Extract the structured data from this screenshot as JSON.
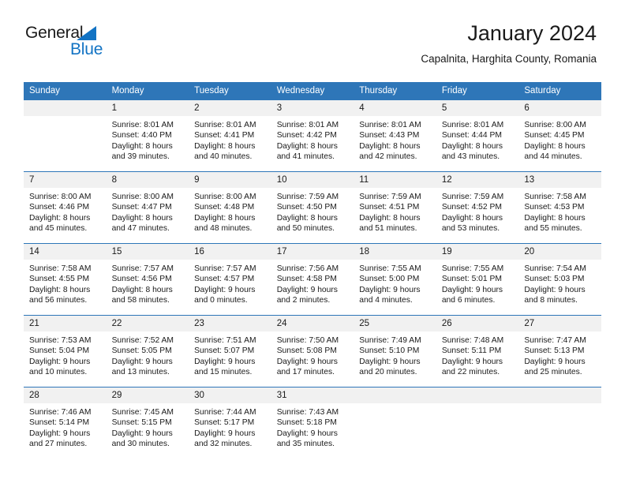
{
  "brand": {
    "name_part1": "General",
    "name_part2": "Blue",
    "triangle_color": "#1273c4"
  },
  "header": {
    "title": "January 2024",
    "location": "Capalnita, Harghita County, Romania"
  },
  "theme": {
    "header_blue": "#2e76b8",
    "daynum_gray": "#f1f1f1",
    "text": "#1a1a1a"
  },
  "labels": {
    "sunrise_prefix": "Sunrise:",
    "sunset_prefix": "Sunset:",
    "daylight_prefix": "Daylight:"
  },
  "weekday_headers": [
    "Sunday",
    "Monday",
    "Tuesday",
    "Wednesday",
    "Thursday",
    "Friday",
    "Saturday"
  ],
  "weeks": [
    [
      {
        "day": "",
        "sunrise": "",
        "sunset": "",
        "daylight_line1": "",
        "daylight_line2": ""
      },
      {
        "day": "1",
        "sunrise": "Sunrise: 8:01 AM",
        "sunset": "Sunset: 4:40 PM",
        "daylight_line1": "Daylight: 8 hours",
        "daylight_line2": "and 39 minutes."
      },
      {
        "day": "2",
        "sunrise": "Sunrise: 8:01 AM",
        "sunset": "Sunset: 4:41 PM",
        "daylight_line1": "Daylight: 8 hours",
        "daylight_line2": "and 40 minutes."
      },
      {
        "day": "3",
        "sunrise": "Sunrise: 8:01 AM",
        "sunset": "Sunset: 4:42 PM",
        "daylight_line1": "Daylight: 8 hours",
        "daylight_line2": "and 41 minutes."
      },
      {
        "day": "4",
        "sunrise": "Sunrise: 8:01 AM",
        "sunset": "Sunset: 4:43 PM",
        "daylight_line1": "Daylight: 8 hours",
        "daylight_line2": "and 42 minutes."
      },
      {
        "day": "5",
        "sunrise": "Sunrise: 8:01 AM",
        "sunset": "Sunset: 4:44 PM",
        "daylight_line1": "Daylight: 8 hours",
        "daylight_line2": "and 43 minutes."
      },
      {
        "day": "6",
        "sunrise": "Sunrise: 8:00 AM",
        "sunset": "Sunset: 4:45 PM",
        "daylight_line1": "Daylight: 8 hours",
        "daylight_line2": "and 44 minutes."
      }
    ],
    [
      {
        "day": "7",
        "sunrise": "Sunrise: 8:00 AM",
        "sunset": "Sunset: 4:46 PM",
        "daylight_line1": "Daylight: 8 hours",
        "daylight_line2": "and 45 minutes."
      },
      {
        "day": "8",
        "sunrise": "Sunrise: 8:00 AM",
        "sunset": "Sunset: 4:47 PM",
        "daylight_line1": "Daylight: 8 hours",
        "daylight_line2": "and 47 minutes."
      },
      {
        "day": "9",
        "sunrise": "Sunrise: 8:00 AM",
        "sunset": "Sunset: 4:48 PM",
        "daylight_line1": "Daylight: 8 hours",
        "daylight_line2": "and 48 minutes."
      },
      {
        "day": "10",
        "sunrise": "Sunrise: 7:59 AM",
        "sunset": "Sunset: 4:50 PM",
        "daylight_line1": "Daylight: 8 hours",
        "daylight_line2": "and 50 minutes."
      },
      {
        "day": "11",
        "sunrise": "Sunrise: 7:59 AM",
        "sunset": "Sunset: 4:51 PM",
        "daylight_line1": "Daylight: 8 hours",
        "daylight_line2": "and 51 minutes."
      },
      {
        "day": "12",
        "sunrise": "Sunrise: 7:59 AM",
        "sunset": "Sunset: 4:52 PM",
        "daylight_line1": "Daylight: 8 hours",
        "daylight_line2": "and 53 minutes."
      },
      {
        "day": "13",
        "sunrise": "Sunrise: 7:58 AM",
        "sunset": "Sunset: 4:53 PM",
        "daylight_line1": "Daylight: 8 hours",
        "daylight_line2": "and 55 minutes."
      }
    ],
    [
      {
        "day": "14",
        "sunrise": "Sunrise: 7:58 AM",
        "sunset": "Sunset: 4:55 PM",
        "daylight_line1": "Daylight: 8 hours",
        "daylight_line2": "and 56 minutes."
      },
      {
        "day": "15",
        "sunrise": "Sunrise: 7:57 AM",
        "sunset": "Sunset: 4:56 PM",
        "daylight_line1": "Daylight: 8 hours",
        "daylight_line2": "and 58 minutes."
      },
      {
        "day": "16",
        "sunrise": "Sunrise: 7:57 AM",
        "sunset": "Sunset: 4:57 PM",
        "daylight_line1": "Daylight: 9 hours",
        "daylight_line2": "and 0 minutes."
      },
      {
        "day": "17",
        "sunrise": "Sunrise: 7:56 AM",
        "sunset": "Sunset: 4:58 PM",
        "daylight_line1": "Daylight: 9 hours",
        "daylight_line2": "and 2 minutes."
      },
      {
        "day": "18",
        "sunrise": "Sunrise: 7:55 AM",
        "sunset": "Sunset: 5:00 PM",
        "daylight_line1": "Daylight: 9 hours",
        "daylight_line2": "and 4 minutes."
      },
      {
        "day": "19",
        "sunrise": "Sunrise: 7:55 AM",
        "sunset": "Sunset: 5:01 PM",
        "daylight_line1": "Daylight: 9 hours",
        "daylight_line2": "and 6 minutes."
      },
      {
        "day": "20",
        "sunrise": "Sunrise: 7:54 AM",
        "sunset": "Sunset: 5:03 PM",
        "daylight_line1": "Daylight: 9 hours",
        "daylight_line2": "and 8 minutes."
      }
    ],
    [
      {
        "day": "21",
        "sunrise": "Sunrise: 7:53 AM",
        "sunset": "Sunset: 5:04 PM",
        "daylight_line1": "Daylight: 9 hours",
        "daylight_line2": "and 10 minutes."
      },
      {
        "day": "22",
        "sunrise": "Sunrise: 7:52 AM",
        "sunset": "Sunset: 5:05 PM",
        "daylight_line1": "Daylight: 9 hours",
        "daylight_line2": "and 13 minutes."
      },
      {
        "day": "23",
        "sunrise": "Sunrise: 7:51 AM",
        "sunset": "Sunset: 5:07 PM",
        "daylight_line1": "Daylight: 9 hours",
        "daylight_line2": "and 15 minutes."
      },
      {
        "day": "24",
        "sunrise": "Sunrise: 7:50 AM",
        "sunset": "Sunset: 5:08 PM",
        "daylight_line1": "Daylight: 9 hours",
        "daylight_line2": "and 17 minutes."
      },
      {
        "day": "25",
        "sunrise": "Sunrise: 7:49 AM",
        "sunset": "Sunset: 5:10 PM",
        "daylight_line1": "Daylight: 9 hours",
        "daylight_line2": "and 20 minutes."
      },
      {
        "day": "26",
        "sunrise": "Sunrise: 7:48 AM",
        "sunset": "Sunset: 5:11 PM",
        "daylight_line1": "Daylight: 9 hours",
        "daylight_line2": "and 22 minutes."
      },
      {
        "day": "27",
        "sunrise": "Sunrise: 7:47 AM",
        "sunset": "Sunset: 5:13 PM",
        "daylight_line1": "Daylight: 9 hours",
        "daylight_line2": "and 25 minutes."
      }
    ],
    [
      {
        "day": "28",
        "sunrise": "Sunrise: 7:46 AM",
        "sunset": "Sunset: 5:14 PM",
        "daylight_line1": "Daylight: 9 hours",
        "daylight_line2": "and 27 minutes."
      },
      {
        "day": "29",
        "sunrise": "Sunrise: 7:45 AM",
        "sunset": "Sunset: 5:15 PM",
        "daylight_line1": "Daylight: 9 hours",
        "daylight_line2": "and 30 minutes."
      },
      {
        "day": "30",
        "sunrise": "Sunrise: 7:44 AM",
        "sunset": "Sunset: 5:17 PM",
        "daylight_line1": "Daylight: 9 hours",
        "daylight_line2": "and 32 minutes."
      },
      {
        "day": "31",
        "sunrise": "Sunrise: 7:43 AM",
        "sunset": "Sunset: 5:18 PM",
        "daylight_line1": "Daylight: 9 hours",
        "daylight_line2": "and 35 minutes."
      },
      {
        "day": "",
        "sunrise": "",
        "sunset": "",
        "daylight_line1": "",
        "daylight_line2": ""
      },
      {
        "day": "",
        "sunrise": "",
        "sunset": "",
        "daylight_line1": "",
        "daylight_line2": ""
      },
      {
        "day": "",
        "sunrise": "",
        "sunset": "",
        "daylight_line1": "",
        "daylight_line2": ""
      }
    ]
  ]
}
